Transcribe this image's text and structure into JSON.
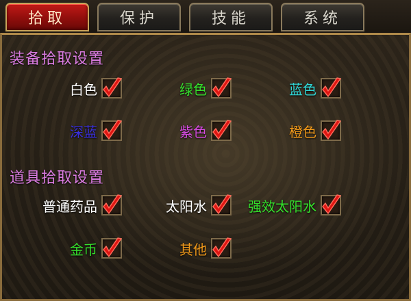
{
  "tabs": [
    {
      "label": "拾取",
      "active": true
    },
    {
      "label": "保护",
      "active": false
    },
    {
      "label": "技能",
      "active": false
    },
    {
      "label": "系统",
      "active": false
    }
  ],
  "equip_section": {
    "title": "装备拾取设置",
    "options": [
      {
        "label": "白色",
        "color": "#ffffff",
        "checked": true
      },
      {
        "label": "绿色",
        "color": "#35e02c",
        "checked": true
      },
      {
        "label": "蓝色",
        "color": "#2fd9d9",
        "checked": true
      },
      {
        "label": "深蓝",
        "color": "#3a2fd9",
        "checked": true
      },
      {
        "label": "紫色",
        "color": "#d54be0",
        "checked": true
      },
      {
        "label": "橙色",
        "color": "#f29a1a",
        "checked": true
      }
    ]
  },
  "item_section": {
    "title": "道具拾取设置",
    "options": [
      {
        "label": "普通药品",
        "color": "#ffffff",
        "checked": true
      },
      {
        "label": "太阳水",
        "color": "#ffffff",
        "checked": true
      },
      {
        "label": "强效太阳水",
        "color": "#35e02c",
        "checked": true
      },
      {
        "label": "金币",
        "color": "#35e02c",
        "checked": true
      },
      {
        "label": "其他",
        "color": "#f29a1a",
        "checked": true
      }
    ]
  },
  "check_icon": "red-checkmark-icon",
  "accent_color": "#b0120f"
}
